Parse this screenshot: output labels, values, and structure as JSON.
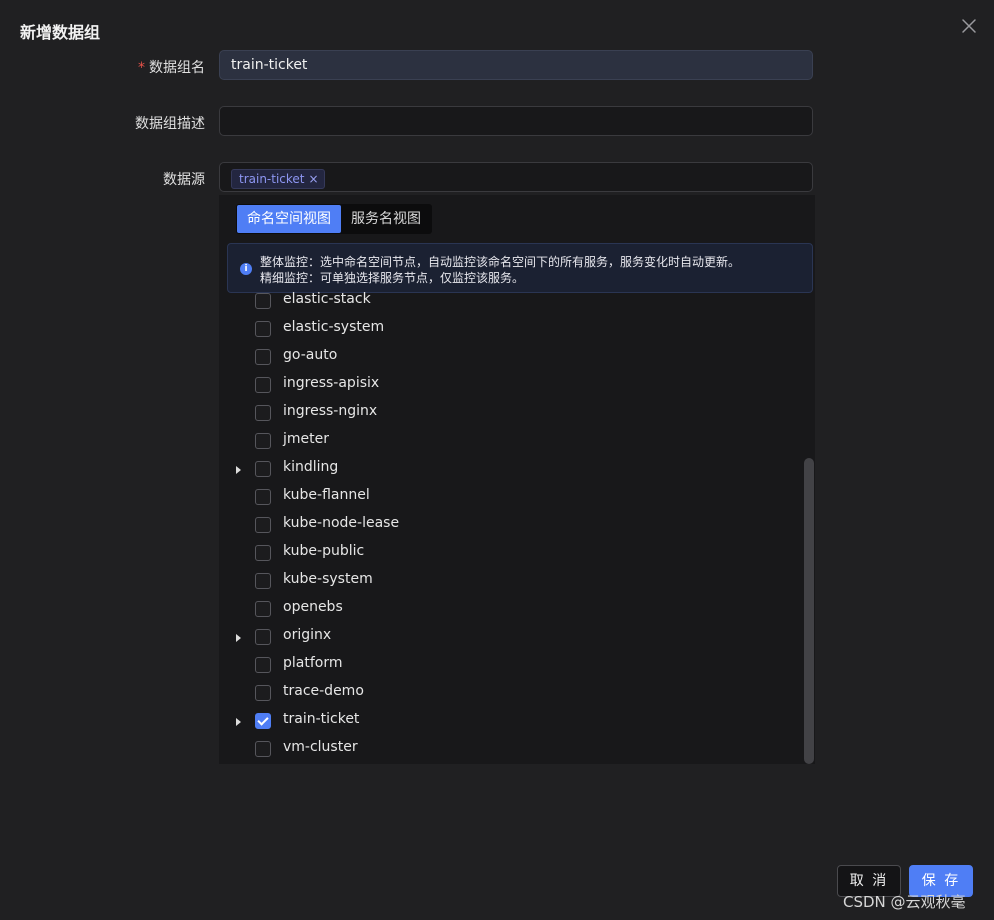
{
  "dialog": {
    "title": "新增数据组"
  },
  "form": {
    "name_label": "数据组名",
    "name_value": "train-ticket",
    "desc_label": "数据组描述",
    "desc_value": "",
    "source_label": "数据源",
    "selected_tag": "train-ticket"
  },
  "dropdown": {
    "views": [
      "命名空间视图",
      "服务名视图"
    ],
    "active_view": "命名空间视图",
    "info": {
      "line1": "整体监控：选中命名空间节点，自动监控该命名空间下的所有服务，服务变化时自动更新。",
      "line2": "精细监控：可单独选择服务节点，仅监控该服务。"
    },
    "items": [
      {
        "label": "elastic-stack",
        "expandable": false,
        "checked": false
      },
      {
        "label": "elastic-system",
        "expandable": false,
        "checked": false
      },
      {
        "label": "go-auto",
        "expandable": false,
        "checked": false
      },
      {
        "label": "ingress-apisix",
        "expandable": false,
        "checked": false
      },
      {
        "label": "ingress-nginx",
        "expandable": false,
        "checked": false
      },
      {
        "label": "jmeter",
        "expandable": false,
        "checked": false
      },
      {
        "label": "kindling",
        "expandable": true,
        "checked": false
      },
      {
        "label": "kube-flannel",
        "expandable": false,
        "checked": false
      },
      {
        "label": "kube-node-lease",
        "expandable": false,
        "checked": false
      },
      {
        "label": "kube-public",
        "expandable": false,
        "checked": false
      },
      {
        "label": "kube-system",
        "expandable": false,
        "checked": false
      },
      {
        "label": "openebs",
        "expandable": false,
        "checked": false
      },
      {
        "label": "originx",
        "expandable": true,
        "checked": false
      },
      {
        "label": "platform",
        "expandable": false,
        "checked": false
      },
      {
        "label": "trace-demo",
        "expandable": false,
        "checked": false
      },
      {
        "label": "train-ticket",
        "expandable": true,
        "checked": true
      },
      {
        "label": "vm-cluster",
        "expandable": false,
        "checked": false
      }
    ]
  },
  "footer": {
    "cancel_label": "取 消",
    "save_label": "保 存"
  },
  "watermark": "CSDN @云观秋毫",
  "colors": {
    "primary": "#4f7ef5",
    "required": "#e8534a",
    "background": "#202022"
  }
}
